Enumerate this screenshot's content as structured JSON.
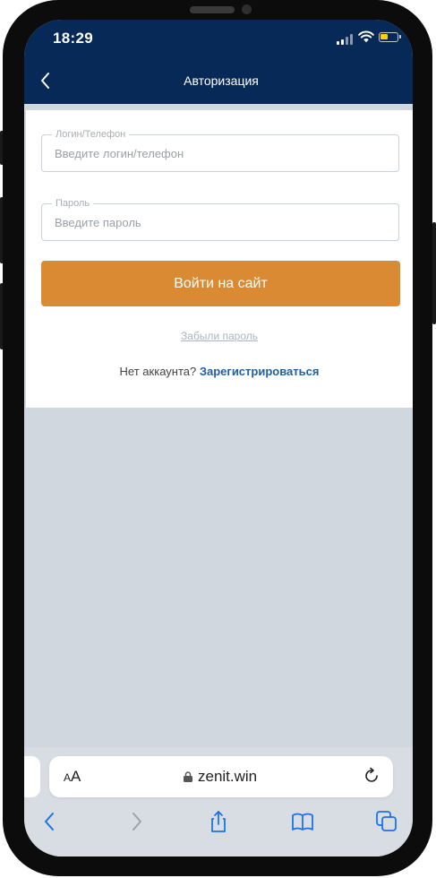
{
  "status_bar": {
    "time": "18:29"
  },
  "nav": {
    "title": "Авторизация",
    "back_icon": "chevron-left-icon"
  },
  "login_form": {
    "login_field": {
      "label": "Логин/Телефон",
      "placeholder": "Введите логин/телефон",
      "value": ""
    },
    "password_field": {
      "label": "Пароль",
      "placeholder": "Введите пароль",
      "value": ""
    },
    "submit_label": "Войти на сайт",
    "forgot_label": "Забыли пароль",
    "no_account_text": "Нет аккаунта?",
    "register_label": "Зарегистрироваться"
  },
  "browser": {
    "text_size_label_small": "A",
    "text_size_label_large": "A",
    "domain": "zenit.win",
    "toolbar_icons": [
      "back-icon",
      "forward-icon",
      "share-icon",
      "bookmarks-icon",
      "tabs-icon"
    ]
  },
  "colors": {
    "header": "#062957",
    "accent_button": "#d98a33",
    "link": "#1f5fa6",
    "safari_blue": "#1a73e8"
  }
}
